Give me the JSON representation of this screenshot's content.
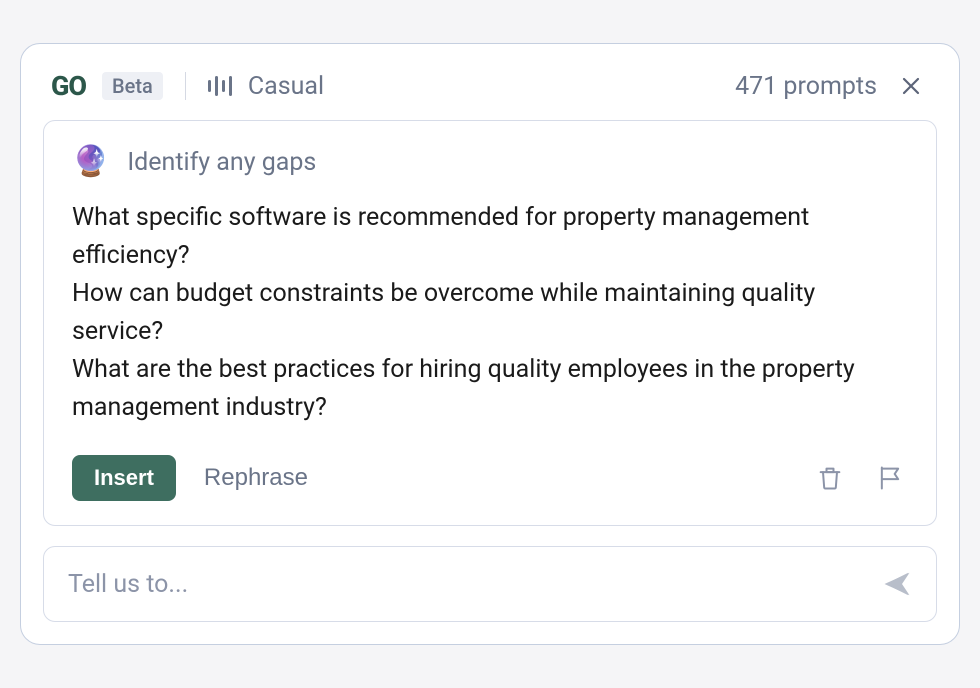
{
  "header": {
    "logo": "GO",
    "beta_label": "Beta",
    "tone_label": "Casual",
    "prompt_count": "471 prompts"
  },
  "card": {
    "icon": "🔮",
    "title": "Identify any gaps",
    "body": "What specific software is recommended for property management efficiency?\nHow can budget constraints be overcome while maintaining quality service?\nWhat are the best practices for hiring quality employees in the property management industry?",
    "insert_label": "Insert",
    "rephrase_label": "Rephrase"
  },
  "input": {
    "placeholder": "Tell us to..."
  }
}
